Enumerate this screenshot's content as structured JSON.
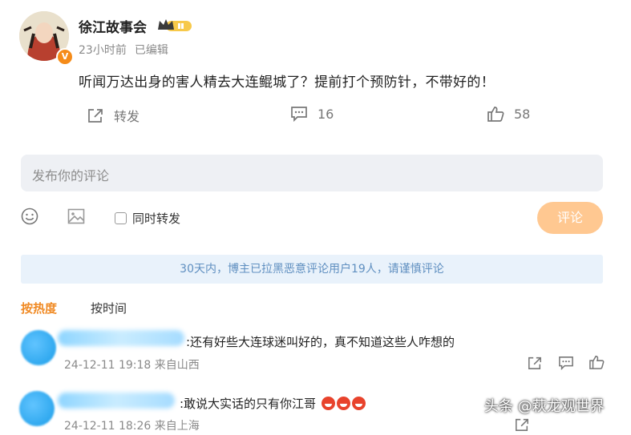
{
  "post": {
    "username": "徐江故事会",
    "time": "23小时前",
    "edited": "已编辑",
    "content": "听闻万达出身的害人精去大连鲲城了？提前打个预防针，不带好的！",
    "repost_label": "转发",
    "comment_count": "16",
    "like_count": "58"
  },
  "composer": {
    "placeholder": "发布你的评论",
    "repost_checkbox_label": "同时转发",
    "submit_label": "评论"
  },
  "notice": "30天内，博主已拉黑恶意评论用户19人，请谨慎评论",
  "sort_tabs": {
    "hot": "按热度",
    "time": "按时间"
  },
  "comments": [
    {
      "text": ":还有好些大连球迷叫好的，真不知道这些人咋想的",
      "meta": "24-12-11 19:18 来自山西"
    },
    {
      "text": ":敢说大实话的只有你江哥",
      "meta": "24-12-11 18:26 来自上海"
    }
  ],
  "watermark": "头条 @萩龙观世界",
  "colors": {
    "accent": "#f08a24",
    "submit_button": "#ffc891",
    "notice_text": "#5f8fc0",
    "notice_bg": "#e9f2fb"
  }
}
